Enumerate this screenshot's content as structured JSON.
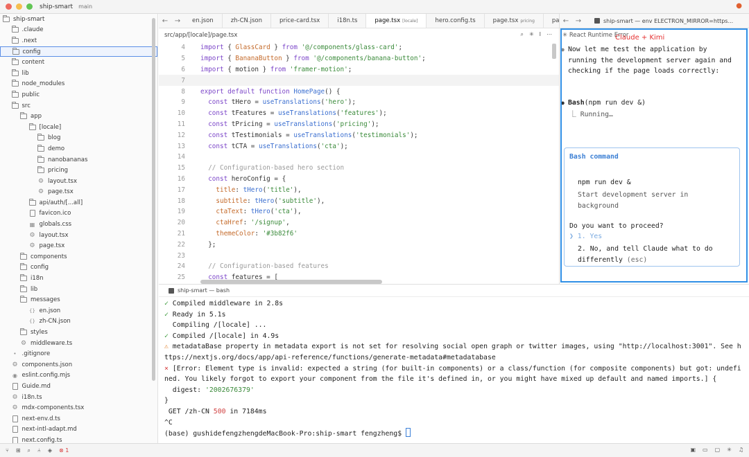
{
  "titlebar": {
    "project": "ship-smart",
    "branch": "main"
  },
  "sidebar": {
    "items": [
      {
        "label": "ship-smart",
        "depth": 0,
        "type": "folder-open"
      },
      {
        "label": ".claude",
        "depth": 1,
        "type": "folder"
      },
      {
        "label": ".next",
        "depth": 1,
        "type": "folder"
      },
      {
        "label": "config",
        "depth": 1,
        "type": "folder",
        "selected": true
      },
      {
        "label": "content",
        "depth": 1,
        "type": "folder"
      },
      {
        "label": "lib",
        "depth": 1,
        "type": "folder"
      },
      {
        "label": "node_modules",
        "depth": 1,
        "type": "folder"
      },
      {
        "label": "public",
        "depth": 1,
        "type": "folder"
      },
      {
        "label": "src",
        "depth": 1,
        "type": "folder-open"
      },
      {
        "label": "app",
        "depth": 2,
        "type": "folder-open"
      },
      {
        "label": "[locale]",
        "depth": 3,
        "type": "folder-open"
      },
      {
        "label": "blog",
        "depth": 4,
        "type": "folder"
      },
      {
        "label": "demo",
        "depth": 4,
        "type": "folder"
      },
      {
        "label": "nanobananas",
        "depth": 4,
        "type": "folder"
      },
      {
        "label": "pricing",
        "depth": 4,
        "type": "folder"
      },
      {
        "label": "layout.tsx",
        "depth": 4,
        "type": "gear"
      },
      {
        "label": "page.tsx",
        "depth": 4,
        "type": "gear"
      },
      {
        "label": "api/auth/[...all]",
        "depth": 3,
        "type": "folder"
      },
      {
        "label": "favicon.ico",
        "depth": 3,
        "type": "file"
      },
      {
        "label": "globals.css",
        "depth": 3,
        "type": "grid"
      },
      {
        "label": "layout.tsx",
        "depth": 3,
        "type": "gear"
      },
      {
        "label": "page.tsx",
        "depth": 3,
        "type": "gear"
      },
      {
        "label": "components",
        "depth": 2,
        "type": "folder"
      },
      {
        "label": "config",
        "depth": 2,
        "type": "folder"
      },
      {
        "label": "i18n",
        "depth": 2,
        "type": "folder"
      },
      {
        "label": "lib",
        "depth": 2,
        "type": "folder"
      },
      {
        "label": "messages",
        "depth": 2,
        "type": "folder-open"
      },
      {
        "label": "en.json",
        "depth": 3,
        "type": "braces"
      },
      {
        "label": "zh-CN.json",
        "depth": 3,
        "type": "braces"
      },
      {
        "label": "styles",
        "depth": 2,
        "type": "folder"
      },
      {
        "label": "middleware.ts",
        "depth": 2,
        "type": "gear"
      },
      {
        "label": ".gitignore",
        "depth": 1,
        "type": "dot"
      },
      {
        "label": "components.json",
        "depth": 1,
        "type": "gear"
      },
      {
        "label": "eslint.config.mjs",
        "depth": 1,
        "type": "circle"
      },
      {
        "label": "Guide.md",
        "depth": 1,
        "type": "file"
      },
      {
        "label": "i18n.ts",
        "depth": 1,
        "type": "gear"
      },
      {
        "label": "mdx-components.tsx",
        "depth": 1,
        "type": "gear"
      },
      {
        "label": "next-env.d.ts",
        "depth": 1,
        "type": "file"
      },
      {
        "label": "next-intl-adapt.md",
        "depth": 1,
        "type": "file"
      },
      {
        "label": "next.config.ts",
        "depth": 1,
        "type": "file"
      }
    ]
  },
  "editor": {
    "tabs": [
      {
        "label": "en.json",
        "sub": ""
      },
      {
        "label": "zh-CN.json",
        "sub": ""
      },
      {
        "label": "price-card.tsx",
        "sub": ""
      },
      {
        "label": "i18n.ts",
        "sub": ""
      },
      {
        "label": "page.tsx",
        "sub": "[locale]",
        "active": true
      },
      {
        "label": "hero.config.ts",
        "sub": ""
      },
      {
        "label": "page.tsx",
        "sub": "pricing"
      },
      {
        "label": "pa",
        "sub": ""
      }
    ],
    "breadcrumb": "src/app/[locale]/page.tsx",
    "lines": [
      {
        "n": "4",
        "html": "<span class='kw'>import</span> { <span class='ty'>GlassCard</span> } <span class='kw'>from</span> <span class='st'>'@/components/glass-card'</span>;"
      },
      {
        "n": "5",
        "html": "<span class='kw'>import</span> { <span class='ty'>BananaButton</span> } <span class='kw'>from</span> <span class='st'>'@/components/banana-button'</span>;"
      },
      {
        "n": "6",
        "html": "<span class='kw'>import</span> { motion } <span class='kw'>from</span> <span class='st'>'framer-motion'</span>;"
      },
      {
        "n": "7",
        "html": "",
        "current": true
      },
      {
        "n": "8",
        "html": "<span class='kw'>export default function</span> <span class='fn'>HomePage</span>() {"
      },
      {
        "n": "9",
        "html": "  <span class='kw'>const</span> tHero = <span class='fn'>useTranslations</span>(<span class='st'>'hero'</span>);"
      },
      {
        "n": "10",
        "html": "  <span class='kw'>const</span> tFeatures = <span class='fn'>useTranslations</span>(<span class='st'>'features'</span>);"
      },
      {
        "n": "11",
        "html": "  <span class='kw'>const</span> tPricing = <span class='fn'>useTranslations</span>(<span class='st'>'pricing'</span>);"
      },
      {
        "n": "12",
        "html": "  <span class='kw'>const</span> tTestimonials = <span class='fn'>useTranslations</span>(<span class='st'>'testimonials'</span>);"
      },
      {
        "n": "13",
        "html": "  <span class='kw'>const</span> tCTA = <span class='fn'>useTranslations</span>(<span class='st'>'cta'</span>);"
      },
      {
        "n": "14",
        "html": ""
      },
      {
        "n": "15",
        "html": "  <span class='cm'>// Configuration-based hero section</span>"
      },
      {
        "n": "16",
        "html": "  <span class='kw'>const</span> heroConfig = {"
      },
      {
        "n": "17",
        "html": "    <span class='ty'>title</span>: <span class='fn'>tHero</span>(<span class='st'>'title'</span>),"
      },
      {
        "n": "18",
        "html": "    <span class='ty'>subtitle</span>: <span class='fn'>tHero</span>(<span class='st'>'subtitle'</span>),"
      },
      {
        "n": "19",
        "html": "    <span class='ty'>ctaText</span>: <span class='fn'>tHero</span>(<span class='st'>'cta'</span>),"
      },
      {
        "n": "20",
        "html": "    <span class='ty'>ctaHref</span>: <span class='st'>'/signup'</span>,"
      },
      {
        "n": "21",
        "html": "    <span class='ty'>themeColor</span>: <span class='st'>'#3b82f6'</span>"
      },
      {
        "n": "22",
        "html": "  };"
      },
      {
        "n": "23",
        "html": ""
      },
      {
        "n": "24",
        "html": "  <span class='cm'>// Configuration-based features</span>"
      },
      {
        "n": "25",
        "html": "  <span class='kw'>const</span> features = ["
      }
    ]
  },
  "right_panel": {
    "tab_label": "ship-smart — env ELECTRON_MIRROR=https...",
    "error_title": "React Runtime Error",
    "annotation": "Claude + Kimi",
    "message": "Now let me test the application by running the development server again and checking if the page loads correctly:",
    "bash_name": "Bash",
    "bash_args": "(npm run dev &)",
    "running": "Running…",
    "box_title": "Bash command",
    "box_cmd": "npm run dev &",
    "box_desc": "Start development server in background",
    "question": "Do you want to proceed?",
    "option1": "❯ 1. Yes",
    "option2": "2. No, and tell Claude what to do differently",
    "option2_hint": "(esc)"
  },
  "terminal": {
    "tab_label": "ship-smart — bash",
    "lines": [
      "<span class='ok'>✓</span> Compiled middleware in 2.8s",
      "<span class='ok'>✓</span> Ready in 5.1s",
      "  Compiling /[locale] ...",
      "<span class='ok'>✓</span> Compiled /[locale] in 4.9s",
      "<span class='warn'>⚠</span> metadataBase property in metadata export is not set for resolving social open graph or twitter images, using \"http://localhost:3001\". See https://nextjs.org/docs/app/api-reference/functions/generate-metadata#metadatabase",
      "<span class='err'>⨯</span> [Error: Element type is invalid: expected a string (for built-in components) or a class/function (for composite components) but got: undefined. You likely forgot to export your component from the file it's defined in, or you might have mixed up default and named imports.] {",
      "  digest: <span class='str'>'2002676379'</span>",
      "}",
      " GET /zh-CN <span class='num'>500</span> in 7184ms",
      "^C",
      "(base) gushidefengzhengdeMacBook-Pro:ship-smart fengzheng$ <span class='cursor'></span>"
    ]
  },
  "statusbar": {
    "errors": "1"
  }
}
